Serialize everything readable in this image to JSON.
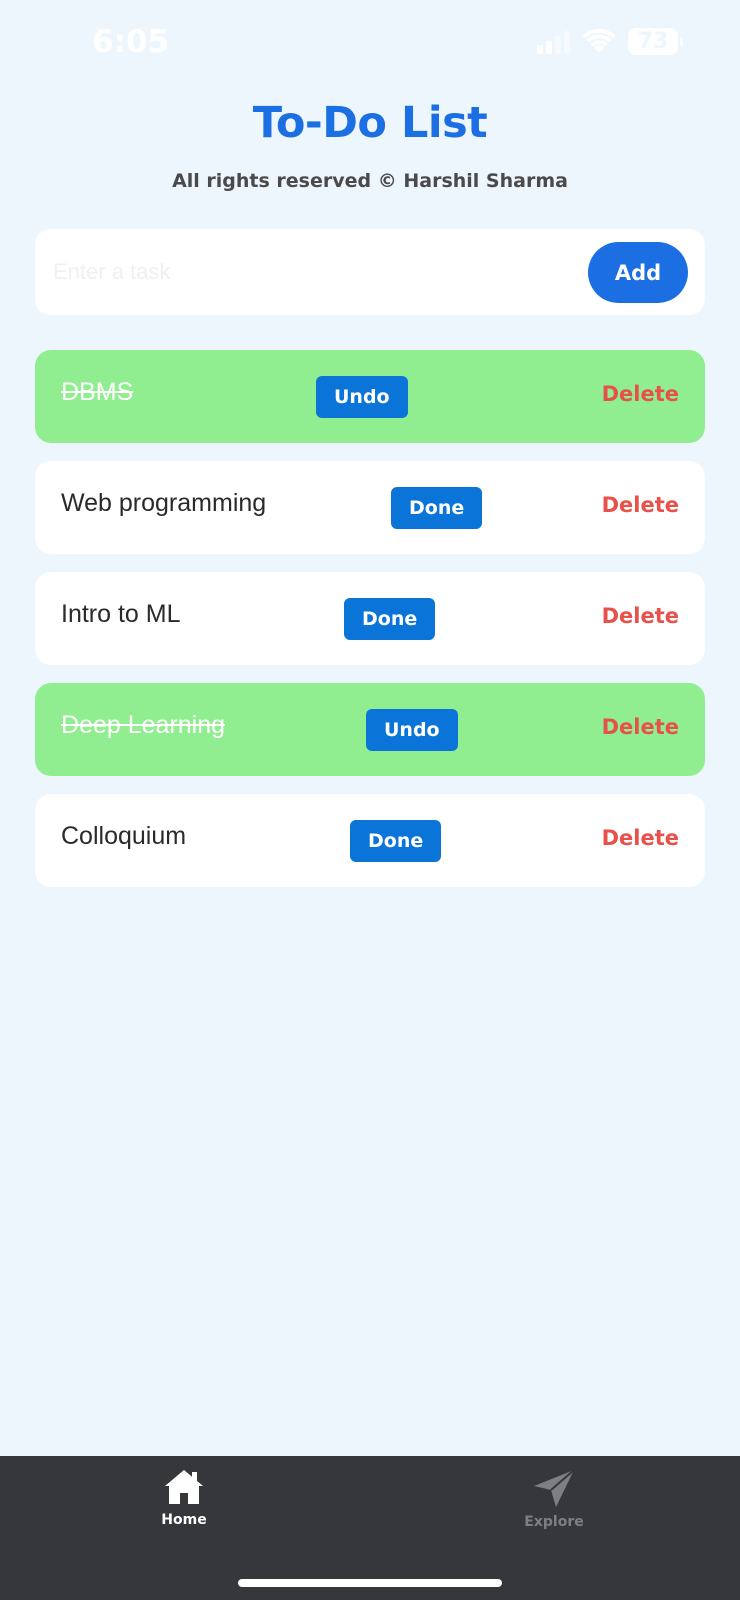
{
  "status_bar": {
    "time": "6:05",
    "battery": "73"
  },
  "header": {
    "title": "To-Do List",
    "subtitle": "All rights reserved © Harshil Sharma"
  },
  "new_task": {
    "placeholder": "Enter a task",
    "value": "",
    "add_label": "Add"
  },
  "tasks": [
    {
      "text": "DBMS",
      "completed": true,
      "toggle_label": "Undo",
      "delete_label": "Delete"
    },
    {
      "text": "Web programming",
      "completed": false,
      "toggle_label": "Done",
      "delete_label": "Delete"
    },
    {
      "text": "Intro to ML",
      "completed": false,
      "toggle_label": "Done",
      "delete_label": "Delete"
    },
    {
      "text": "Deep Learning",
      "completed": true,
      "toggle_label": "Undo",
      "delete_label": "Delete"
    },
    {
      "text": "Colloquium",
      "completed": false,
      "toggle_label": "Done",
      "delete_label": "Delete"
    }
  ],
  "tab_bar": {
    "home": {
      "label": "Home",
      "icon": "home-icon",
      "active": true
    },
    "explore": {
      "label": "Explore",
      "icon": "paper-plane-icon",
      "active": false
    }
  },
  "colors": {
    "accent": "#1c6fe3",
    "completed_row": "#90ee90",
    "delete": "#e8504a",
    "background": "#eef6fd",
    "tab_bar": "#35373a"
  }
}
